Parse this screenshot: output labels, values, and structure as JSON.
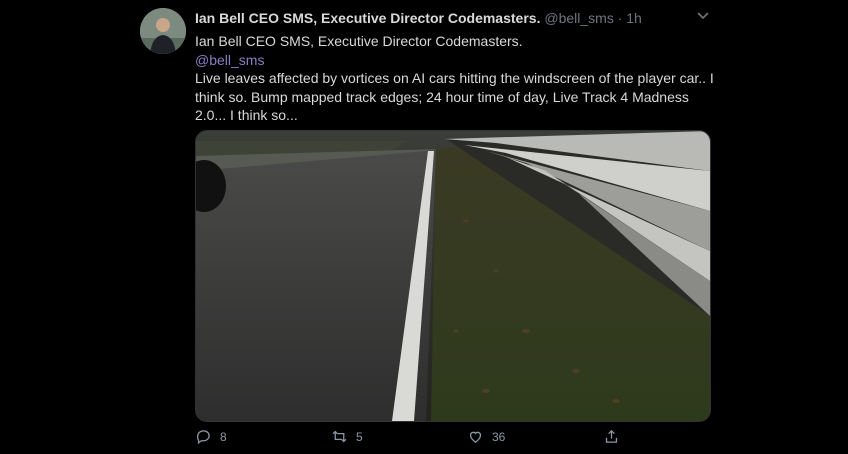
{
  "tweet": {
    "author_name": "Ian Bell CEO SMS, Executive Director Codemasters.",
    "handle": "@bell_sms",
    "separator": "·",
    "time": "1h",
    "text_line1": "Ian Bell CEO SMS, Executive Director Codemasters.",
    "mention": "@bell_sms",
    "text_line2": "Live leaves affected by vortices on AI cars hitting the windscreen of the player car.. I think so. Bump mapped track edges; 24 hour time of day, Live Track 4 Madness 2.0... I think so..."
  },
  "actions": {
    "reply_count": "8",
    "retweet_count": "5",
    "like_count": "36"
  },
  "icons": {
    "reply": "reply-icon",
    "retweet": "retweet-icon",
    "like": "heart-icon",
    "share": "share-icon",
    "more": "chevron-down-icon"
  },
  "colors": {
    "background": "#000000",
    "text": "#d9d9d9",
    "muted": "#6e767d",
    "mention": "#8e7cc3"
  }
}
